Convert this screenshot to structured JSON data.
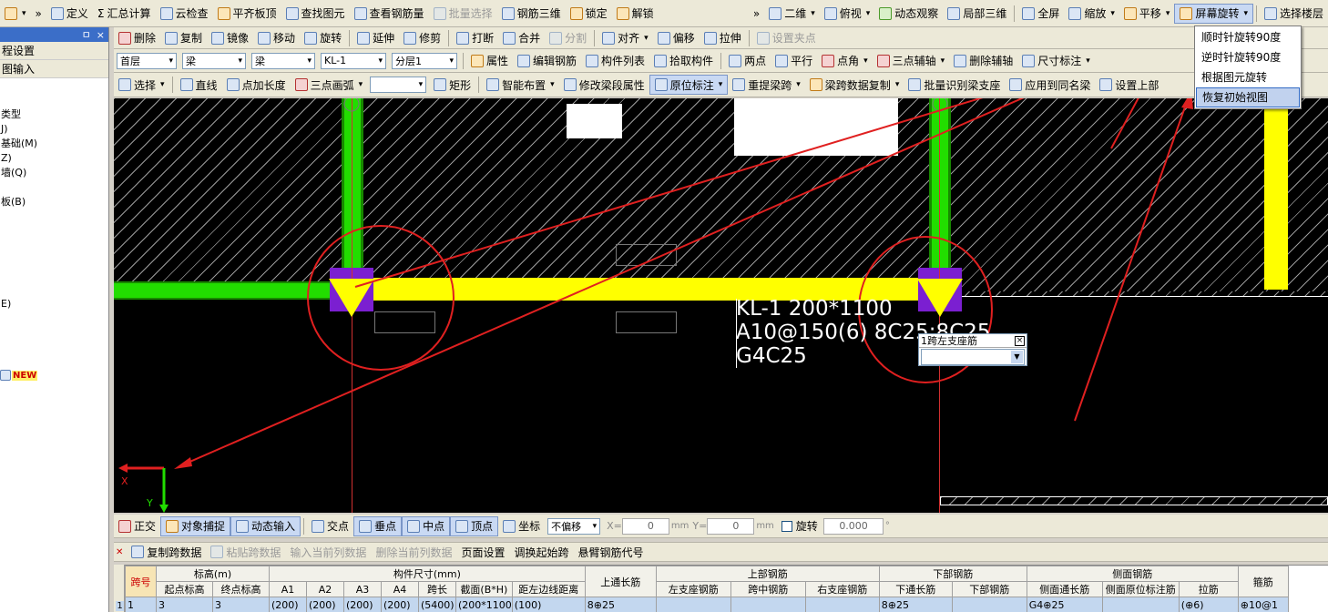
{
  "toolbar1": {
    "items": [
      {
        "label": "»",
        "icon": "overflow-chevron"
      },
      {
        "label": "定义",
        "icon": "define-icon"
      },
      {
        "label": "汇总计算",
        "icon": "sigma-icon",
        "prefix": "Σ"
      },
      {
        "label": "云检查",
        "icon": "cloud-check-icon"
      },
      {
        "label": "平齐板顶",
        "icon": "align-slab-icon"
      },
      {
        "label": "查找图元",
        "icon": "find-icon"
      },
      {
        "label": "查看钢筋量",
        "icon": "rebar-qty-icon"
      },
      {
        "label": "批量选择",
        "icon": "batch-select-icon",
        "disabled": true
      },
      {
        "label": "钢筋三维",
        "icon": "rebar-3d-icon"
      },
      {
        "label": "锁定",
        "icon": "lock-icon"
      },
      {
        "label": "解锁",
        "icon": "unlock-icon"
      }
    ],
    "right_items": [
      "»",
      "二维",
      "俯视",
      "动态观察",
      "局部三维",
      "全屏",
      "缩放",
      "平移",
      "屏幕旋转",
      "选择楼层"
    ]
  },
  "toolbar2": {
    "items": [
      "删除",
      "复制",
      "镜像",
      "移动",
      "旋转",
      "延伸",
      "修剪",
      "打断",
      "合并",
      "分割",
      "对齐",
      "偏移",
      "拉伸",
      "设置夹点"
    ],
    "disabled": [
      "分割",
      "设置夹点"
    ]
  },
  "toolbar3": {
    "floor": "首层",
    "category": "梁",
    "type": "梁",
    "element": "KL-1",
    "layer": "分层1",
    "items": [
      "属性",
      "编辑钢筋",
      "构件列表",
      "拾取构件",
      "两点",
      "平行",
      "点角",
      "三点辅轴",
      "删除辅轴",
      "尺寸标注"
    ]
  },
  "toolbar4": {
    "items": [
      "选择",
      "直线",
      "点加长度",
      "三点画弧",
      "矩形",
      "智能布置",
      "修改梁段属性",
      "原位标注",
      "重提梁跨",
      "梁跨数据复制",
      "批量识别梁支座",
      "应用到同名梁",
      "设置上部"
    ]
  },
  "left_panel": {
    "pin": "ㅁ",
    "close": "×",
    "rows": [
      "程设置",
      "图输入"
    ],
    "tree": [
      "类型",
      "J)",
      "基础(M)",
      "Z)",
      "墙(Q)",
      "",
      "板(B)",
      "",
      "",
      "",
      "",
      "",
      "",
      "E)"
    ],
    "new_badge": "NEW"
  },
  "rotate_menu": {
    "items": [
      "顺时针旋转90度",
      "逆时针旋转90度",
      "根据图元旋转",
      "恢复初始视图"
    ],
    "highlighted_index": 3
  },
  "canvas": {
    "beam_label": [
      "KL-1 200*1100",
      "A10@150(6) 8C25;8C25",
      "G4C25"
    ],
    "popup_title": "1跨左支座筋",
    "axis_x": "X",
    "axis_y": "Y",
    "colors": {
      "beam": "#ffff00",
      "column": "#22dd00",
      "support": "#7b1fd1",
      "annotation": "#ff0000",
      "background": "#000000"
    }
  },
  "snap_bar": {
    "items": [
      "正交",
      "对象捕捉",
      "动态输入",
      "交点",
      "垂点",
      "中点",
      "顶点",
      "坐标"
    ],
    "offset": "不偏移",
    "x_label": "X=",
    "x_value": "0",
    "y_label": "Y=",
    "y_value": "0",
    "unit": "mm",
    "rotate_label": "旋转",
    "rotate_value": "0.000",
    "degree": "°"
  },
  "grid_toolbar": {
    "items": [
      "复制跨数据",
      "粘贴跨数据",
      "输入当前列数据",
      "删除当前列数据",
      "页面设置",
      "调换起始跨",
      "悬臂钢筋代号"
    ],
    "disabled": [
      "粘贴跨数据",
      "输入当前列数据",
      "删除当前列数据"
    ]
  },
  "grid": {
    "group_headers": [
      "跨号",
      "标高(m)",
      "构件尺寸(mm)",
      "上通长筋",
      "上部钢筋",
      "下部钢筋",
      "侧面钢筋",
      "箍筋"
    ],
    "sub_headers": [
      "起点标高",
      "终点标高",
      "A1",
      "A2",
      "A3",
      "A4",
      "跨长",
      "截面(B*H)",
      "距左边线距离",
      "左支座钢筋",
      "跨中钢筋",
      "右支座钢筋",
      "下通长筋",
      "下部钢筋",
      "侧面通长筋",
      "侧面原位标注筋",
      "拉筋"
    ],
    "row": [
      "1",
      "1",
      "3",
      "3",
      "(200)",
      "(200)",
      "(200)",
      "(200)",
      "(5400)",
      "(200*1100",
      "(100)",
      "8⊕25",
      "",
      "",
      "",
      "8⊕25",
      "",
      "G4⊕25",
      "",
      "(⊕6)",
      "⊕10@1"
    ]
  }
}
